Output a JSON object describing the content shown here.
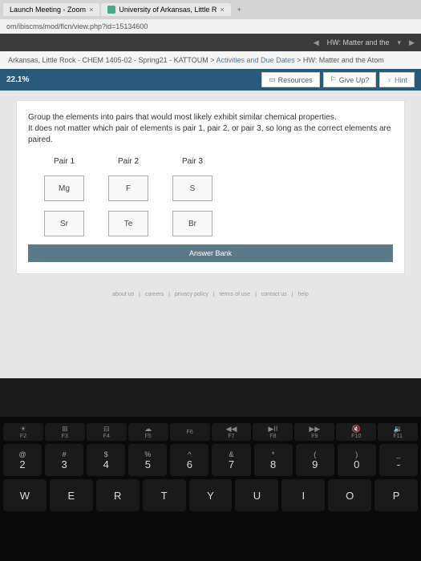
{
  "tabs": {
    "tab1": "Launch Meeting - Zoom",
    "tab2": "University of Arkansas, Little R"
  },
  "url": "om/ibiscms/mod/flcn/view.php?id=15134600",
  "topnav": {
    "title": "HW: Matter and the"
  },
  "breadcrumb": {
    "course": "Arkansas, Little Rock - CHEM 1405-02 - Spring21 - KATTOUM",
    "sep": " > ",
    "activities": "Activities and Due Dates",
    "hw": "HW: Matter and the Atom"
  },
  "progress": {
    "percent": "22.1%",
    "resources": "Resources",
    "giveup": "Give Up?",
    "hint": "Hint"
  },
  "question": {
    "line1": "Group the elements into pairs that would most likely exhibit similar chemical properties.",
    "line2": "It does not matter which pair of elements is pair 1, pair 2, or pair 3, so long as the correct elements are paired."
  },
  "pairs": {
    "p1_label": "Pair 1",
    "p2_label": "Pair 2",
    "p3_label": "Pair 3",
    "p1_e1": "Mg",
    "p1_e2": "Sr",
    "p2_e1": "F",
    "p2_e2": "Te",
    "p3_e1": "S",
    "p3_e2": "Br"
  },
  "answerbank": "Answer Bank",
  "footer": {
    "about": "about us",
    "careers": "careers",
    "privacy": "privacy policy",
    "terms": "terms of use",
    "contact": "contact us",
    "help": "help"
  },
  "keyboard": {
    "fn": [
      "F2",
      "F3",
      "F4",
      "F5",
      "F6",
      "F7",
      "F8",
      "F9",
      "F10",
      "F11"
    ],
    "row1_top": [
      "@",
      "#",
      "$",
      "%",
      "^",
      "&",
      "*",
      "(",
      ")",
      "_"
    ],
    "row1_bot": [
      "2",
      "3",
      "4",
      "5",
      "6",
      "7",
      "8",
      "9",
      "0",
      "-"
    ],
    "row2": [
      "W",
      "E",
      "R",
      "T",
      "Y",
      "U",
      "I",
      "O",
      "P"
    ]
  }
}
